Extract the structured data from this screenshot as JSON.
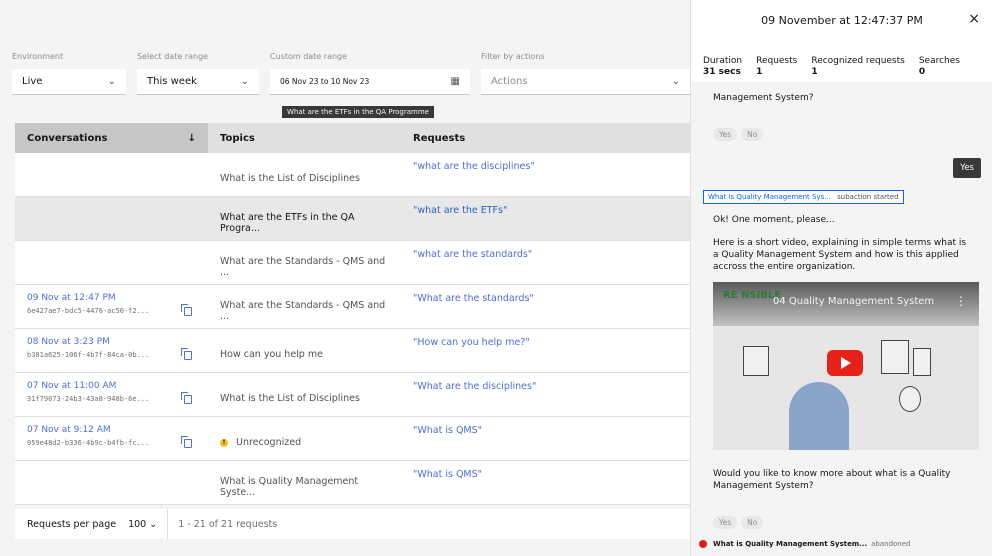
{
  "filters": {
    "environment": {
      "label": "Environment",
      "value": "Live"
    },
    "date_range": {
      "label": "Select date range",
      "value": "This week"
    },
    "custom_range": {
      "label": "Custom date range",
      "value": "06 Nov 23 to 10 Nov 23",
      "tooltip": "What are the ETFs in the QA Programme"
    },
    "actions": {
      "label": "Filter by actions",
      "placeholder": "Actions"
    }
  },
  "table": {
    "headers": {
      "conversations": "Conversations",
      "topics": "Topics",
      "requests": "Requests"
    },
    "rows": [
      {
        "date": "",
        "id": "",
        "topic": "What is the List of Disciplines",
        "request": "\"what are the disciplines\""
      },
      {
        "date": "",
        "id": "",
        "topic": "What are the ETFs in the QA Progra...",
        "request": "\"what are the ETFs\""
      },
      {
        "date": "",
        "id": "",
        "topic": "What are the Standards - QMS and ...",
        "request": "\"what are the standards\""
      },
      {
        "date": "09 Nov at 12:47 PM",
        "id": "6e427ae7-bdc5-4476-ac50-f2...",
        "topic": "What are the Standards - QMS and ...",
        "request": "\"What are the standards\""
      },
      {
        "date": "08 Nov at 3:23 PM",
        "id": "b381a625-106f-4b7f-84ca-0b...",
        "topic": "How can you help me",
        "request": "\"How can you help me?\""
      },
      {
        "date": "07 Nov at 11:00 AM",
        "id": "31f79073-24b3-43a8-948b-6e...",
        "topic": "What is the List of Disciplines",
        "request": "\"What are the disciplines\""
      },
      {
        "date": "07 Nov at 9:12 AM",
        "id": "959e48d2-b336-4b9c-b4fb-fc...",
        "topic": "Unrecognized",
        "request": "\"What is QMS\""
      },
      {
        "date": "",
        "id": "",
        "topic": "What is Quality Management Syste...",
        "request": "\"What is QMS\""
      }
    ],
    "pagination": {
      "per_page_label": "Requests per page",
      "per_page": "100",
      "range": "1 - 21 of 21 requests"
    }
  },
  "panel": {
    "title": "09 November at 12:47:37 PM",
    "close": "×",
    "stats": [
      {
        "label": "Duration",
        "value": "31 secs"
      },
      {
        "label": "Requests",
        "value": "1"
      },
      {
        "label": "Recognized requests",
        "value": "1"
      },
      {
        "label": "Searches",
        "value": "0"
      }
    ],
    "msg_top": "Management System?",
    "chip_yes": "Yes",
    "chip_no": "No",
    "user_msg": "Yes",
    "subaction": {
      "name": "What is Quality Management Sys...",
      "state": "subaction started"
    },
    "msg_wait": "Ok! One moment, please...",
    "msg_video": "Here is a short video, explaining in simple terms what is a Quality Management System and how is this applied accross the entire organization.",
    "video_title": "04 Quality Management System",
    "video_logo": "RE  NSIBLE",
    "msg_more": "Would you like to know more about what is a Quality Management System?",
    "abandoned": {
      "name": "What is Quality Management System...",
      "state": "abandoned"
    }
  }
}
